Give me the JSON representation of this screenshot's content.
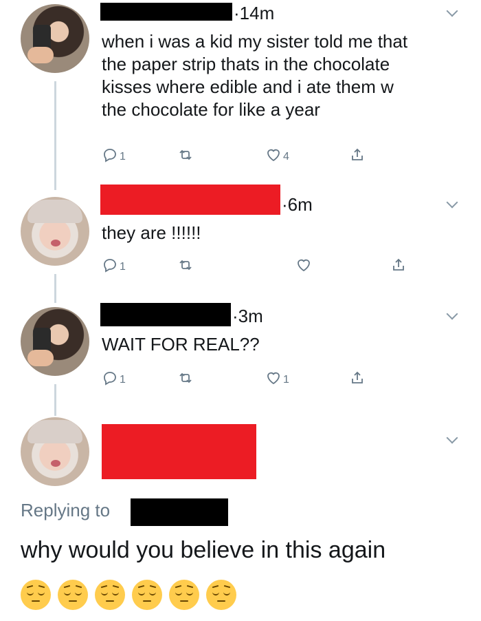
{
  "tweets": [
    {
      "time": "14m",
      "text_lines": [
        "when i was a kid my sister told me that",
        "the paper strip thats in the chocolate",
        "kisses where edible and i ate them w",
        "the chocolate for like a year"
      ],
      "replies": "1",
      "likes": "4",
      "redaction_color": "#000000"
    },
    {
      "time": "6m",
      "text_lines": [
        "they are !!!!!!"
      ],
      "replies": "1",
      "likes": "",
      "redaction_color": "#ec1c24"
    },
    {
      "time": "3m",
      "text_lines": [
        "WAIT FOR REAL??"
      ],
      "replies": "1",
      "likes": "1",
      "redaction_color": "#000000"
    }
  ],
  "main_reply": {
    "replying_label": "Replying to",
    "text": "why would you believe in this again",
    "emoji": "pensive-face",
    "emoji_count": 6
  },
  "icons": {
    "reply": "reply-icon",
    "retweet": "retweet-icon",
    "like": "heart-icon",
    "share": "share-icon",
    "more": "chevron-down-icon"
  }
}
